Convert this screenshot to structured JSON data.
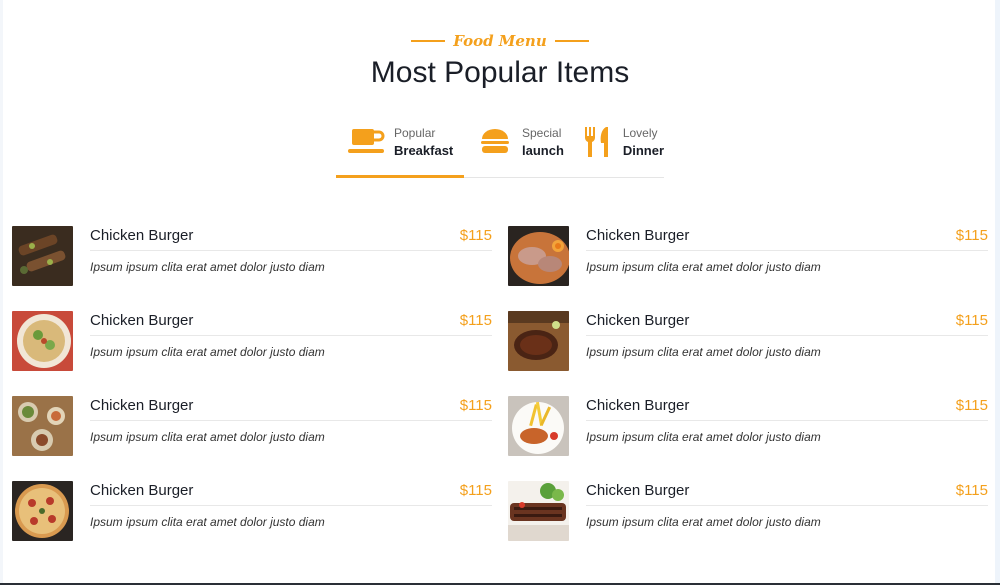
{
  "header": {
    "subtitle": "Food Menu",
    "title": "Most Popular Items"
  },
  "tabs": [
    {
      "small": "Popular",
      "big": "Breakfast",
      "icon": "coffee-cup-icon",
      "active": true
    },
    {
      "small": "Special",
      "big": "launch",
      "icon": "burger-icon",
      "active": false
    },
    {
      "small": "Lovely",
      "big": "Dinner",
      "icon": "fork-knife-icon",
      "active": false
    }
  ],
  "accent_color": "#f4a01c",
  "menu": {
    "items": [
      {
        "name": "Chicken Burger",
        "price": "$115",
        "desc": "Ipsum ipsum clita erat amet dolor justo diam",
        "image": "grilled-skewers-photo"
      },
      {
        "name": "Chicken Burger",
        "price": "$115",
        "desc": "Ipsum ipsum clita erat amet dolor justo diam",
        "image": "ramen-bowl-photo"
      },
      {
        "name": "Chicken Burger",
        "price": "$115",
        "desc": "Ipsum ipsum clita erat amet dolor justo diam",
        "image": "salad-pizza-photo"
      },
      {
        "name": "Chicken Burger",
        "price": "$115",
        "desc": "Ipsum ipsum clita erat amet dolor justo diam",
        "image": "steak-board-photo"
      },
      {
        "name": "Chicken Burger",
        "price": "$115",
        "desc": "Ipsum ipsum clita erat amet dolor justo diam",
        "image": "table-spread-photo"
      },
      {
        "name": "Chicken Burger",
        "price": "$115",
        "desc": "Ipsum ipsum clita erat amet dolor justo diam",
        "image": "fries-plate-photo"
      },
      {
        "name": "Chicken Burger",
        "price": "$115",
        "desc": "Ipsum ipsum clita erat amet dolor justo diam",
        "image": "pizza-photo"
      },
      {
        "name": "Chicken Burger",
        "price": "$115",
        "desc": "Ipsum ipsum clita erat amet dolor justo diam",
        "image": "grilled-meat-photo"
      }
    ]
  }
}
